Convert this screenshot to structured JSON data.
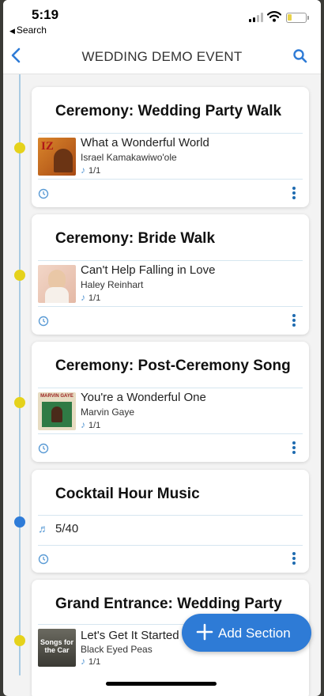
{
  "status_bar": {
    "time": "5:19",
    "back_app": "Search"
  },
  "nav": {
    "title": "WEDDING DEMO EVENT",
    "back_icon": "chevron-left-icon",
    "search_icon": "search-icon"
  },
  "colors": {
    "accent": "#2e7bd6",
    "timeline": "#a9cbe3",
    "dot_yellow": "#e5d21b",
    "dot_blue": "#2f7cd8"
  },
  "sections": [
    {
      "title": "Ceremony: Wedding Party Walk",
      "song": {
        "title": "What a Wonderful World",
        "artist": "Israel Kamakawiwo'ole",
        "count": "1/1"
      }
    },
    {
      "title": "Ceremony: Bride Walk",
      "song": {
        "title": "Can't Help Falling in Love",
        "artist": "Haley Reinhart",
        "count": "1/1"
      }
    },
    {
      "title": "Ceremony: Post-Ceremony Song",
      "song": {
        "title": "You're a Wonderful One",
        "artist": "Marvin Gaye",
        "count": "1/1",
        "art_text": "MARVIN GAYE"
      }
    },
    {
      "title": "Cocktail Hour Music",
      "count": "5/40"
    },
    {
      "title": "Grand Entrance: Wedding Party",
      "song": {
        "title": "Let's Get It Started",
        "artist": "Black Eyed Peas",
        "count": "1/1",
        "art_text": "Songs for the Car"
      }
    }
  ],
  "fab": {
    "label": "Add Section",
    "icon": "plus-icon"
  }
}
